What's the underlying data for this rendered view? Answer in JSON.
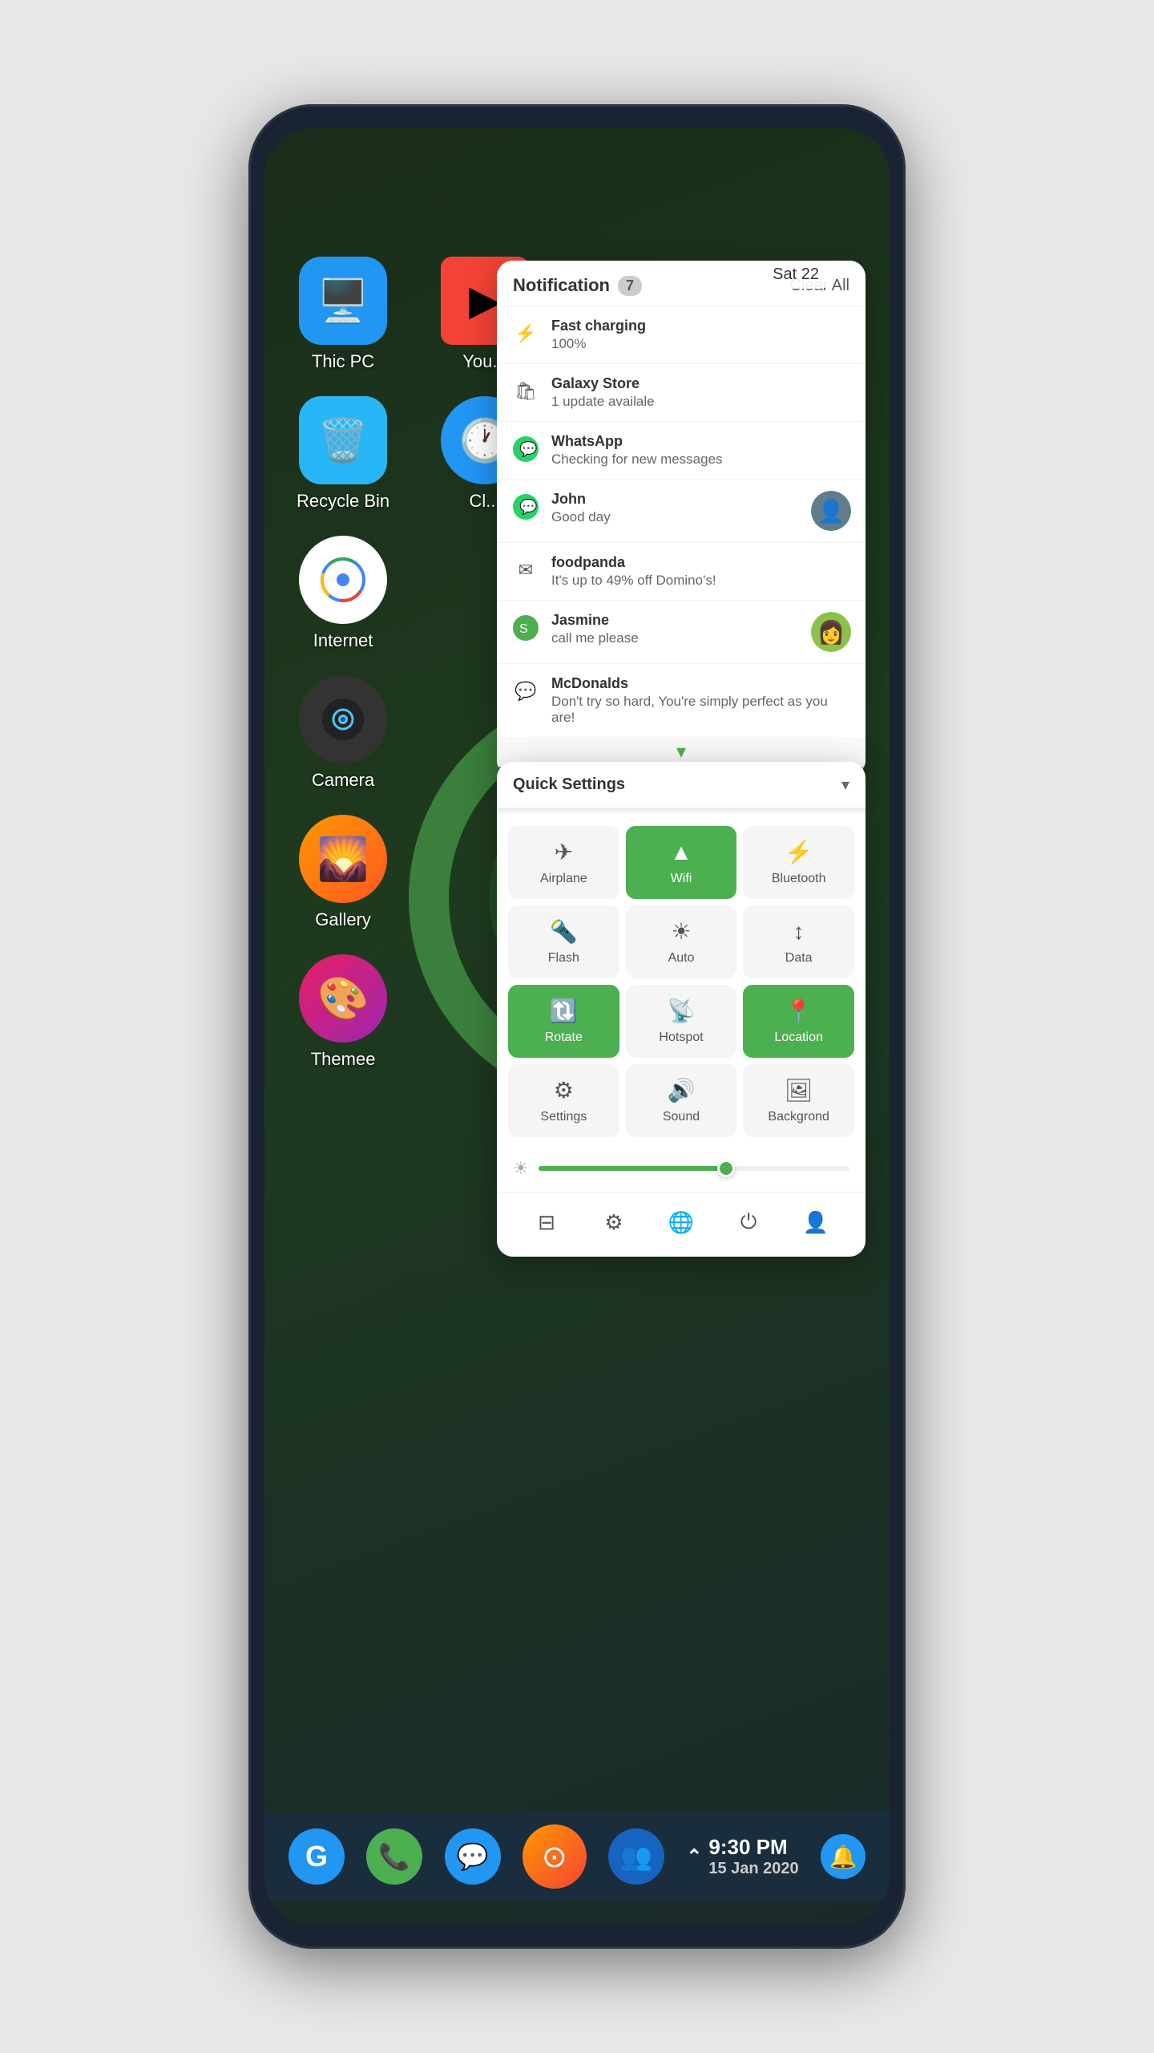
{
  "phone": {
    "date_chip": "Sat 22",
    "status_time": "9:30 PM",
    "status_date": "15 Jan  2020"
  },
  "desktop_icons": [
    {
      "id": "thic-pc",
      "label": "Thic PC",
      "bg": "#2196f3",
      "icon": "🖥",
      "color": "white"
    },
    {
      "id": "recycle-bin",
      "label": "Recycle Bin",
      "bg": "#29b6f6",
      "icon": "🗑",
      "color": "white"
    },
    {
      "id": "internet",
      "label": "Internet",
      "bg": "white",
      "icon": "⬤",
      "color": "#4caf50"
    },
    {
      "id": "camera",
      "label": "Camera",
      "bg": "#444",
      "icon": "📷",
      "color": "white"
    },
    {
      "id": "gallery",
      "label": "Gallery",
      "bg": "#ff9800",
      "icon": "🌄",
      "color": "white"
    },
    {
      "id": "themee",
      "label": "Themee",
      "bg": "#f44336",
      "icon": "🎨",
      "color": "white"
    }
  ],
  "desktop_icons_right": [
    {
      "id": "youtube",
      "label": "You...",
      "bg": "#f44336",
      "icon": "▶",
      "color": "white"
    },
    {
      "id": "clock",
      "label": "Cl...",
      "bg": "#2196f3",
      "icon": "🕐",
      "color": "white"
    }
  ],
  "notifications": {
    "title": "Notification",
    "count": "7",
    "clear_all": "Clear All",
    "items": [
      {
        "id": "charging",
        "app": "Fast charging",
        "message": "100%",
        "icon": "⚡",
        "has_avatar": false
      },
      {
        "id": "galaxy-store",
        "app": "Galaxy Store",
        "message": "1 update availale",
        "icon": "🛍",
        "has_avatar": false
      },
      {
        "id": "whatsapp",
        "app": "WhatsApp",
        "message": "Checking for new messages",
        "icon": "💬",
        "has_avatar": false
      },
      {
        "id": "john",
        "app": "John",
        "message": "Good day",
        "icon": "💬",
        "has_avatar": true,
        "avatar_color": "#607d8b",
        "avatar_icon": "👤"
      },
      {
        "id": "foodpanda",
        "app": "foodpanda",
        "message": "It's up to 49% off Domino's!",
        "icon": "📧",
        "has_avatar": false
      },
      {
        "id": "jasmine",
        "app": "Jasmine",
        "message": "call me please",
        "icon": "💚",
        "has_avatar": true,
        "avatar_color": "#8bc34a",
        "avatar_icon": "👩"
      },
      {
        "id": "mcdonalds",
        "app": "McDonalds",
        "message": "Don't try so hard, You're simply perfect as you are!",
        "icon": "💬",
        "has_avatar": false
      }
    ]
  },
  "quick_settings": {
    "title": "Quick Settings",
    "items": [
      {
        "id": "airplane",
        "label": "Airplane",
        "icon": "✈",
        "active": false
      },
      {
        "id": "wifi",
        "label": "Wifi",
        "icon": "📶",
        "active": true
      },
      {
        "id": "bluetooth",
        "label": "Bluetooth",
        "icon": "⚡",
        "active": false
      },
      {
        "id": "flash",
        "label": "Flash",
        "icon": "🔦",
        "active": false
      },
      {
        "id": "auto",
        "label": "Auto",
        "icon": "☀",
        "active": false
      },
      {
        "id": "data",
        "label": "Data",
        "icon": "↕",
        "active": false
      },
      {
        "id": "rotate",
        "label": "Rotate",
        "icon": "🔃",
        "active": true
      },
      {
        "id": "hotspot",
        "label": "Hotspot",
        "icon": "📡",
        "active": false
      },
      {
        "id": "location",
        "label": "Location",
        "icon": "📍",
        "active": true
      },
      {
        "id": "settings",
        "label": "Settings",
        "icon": "⚙",
        "active": false
      },
      {
        "id": "sound",
        "label": "Sound",
        "icon": "🔊",
        "active": false
      },
      {
        "id": "backgrond",
        "label": "Backgrond",
        "icon": "🖼",
        "active": false
      }
    ],
    "actions": [
      {
        "id": "screenshots",
        "icon": "⊟"
      },
      {
        "id": "settings",
        "icon": "⚙"
      },
      {
        "id": "network",
        "icon": "🌐"
      },
      {
        "id": "power",
        "icon": "⏻"
      },
      {
        "id": "user",
        "icon": "👤"
      }
    ]
  },
  "dock": {
    "items": [
      {
        "id": "google",
        "icon": "G",
        "style": "blue"
      },
      {
        "id": "phone",
        "icon": "📞",
        "style": "phone"
      },
      {
        "id": "sms",
        "icon": "💬",
        "style": "sms"
      },
      {
        "id": "messenger",
        "icon": "⊙",
        "style": "orange"
      },
      {
        "id": "contacts",
        "icon": "👥",
        "style": "contacts"
      }
    ],
    "up_arrow": "⌃",
    "notification_bell": "🔔"
  }
}
